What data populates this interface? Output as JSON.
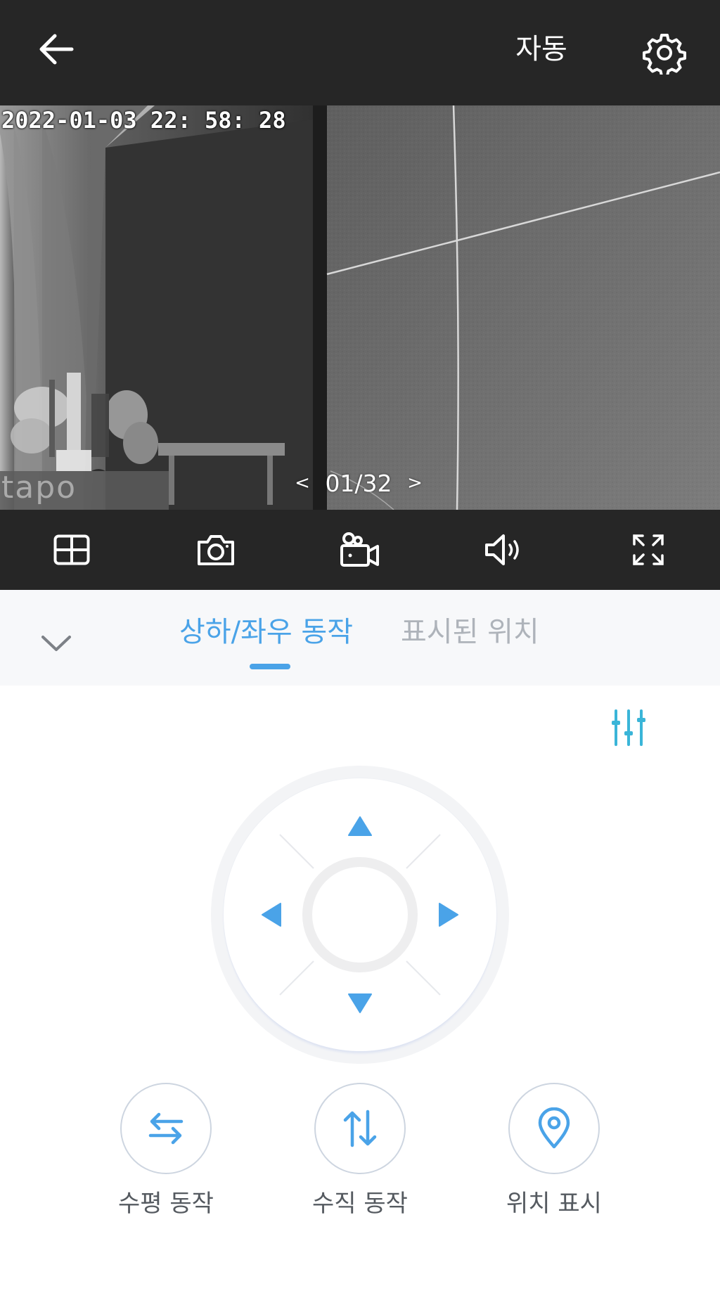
{
  "header": {
    "mode_label": "자동",
    "back_icon": "arrow-left-icon",
    "settings_icon": "gear-icon"
  },
  "video": {
    "timestamp": "2022-01-03  22: 58: 28",
    "watermark": "tapo",
    "pager": {
      "prev": "<",
      "current": "01/32",
      "next": ">"
    }
  },
  "controls": [
    {
      "name": "layout-grid-button",
      "icon": "grid-icon"
    },
    {
      "name": "snapshot-button",
      "icon": "camera-icon"
    },
    {
      "name": "record-button",
      "icon": "video-camera-icon"
    },
    {
      "name": "audio-button",
      "icon": "speaker-icon"
    },
    {
      "name": "fullscreen-button",
      "icon": "expand-icon"
    }
  ],
  "tabs": {
    "active": "상하/좌우 동작",
    "inactive": "표시된 위치"
  },
  "actions": [
    {
      "label": "수평 동작",
      "icon": "horizontal-arrows-icon"
    },
    {
      "label": "수직 동작",
      "icon": "vertical-arrows-icon"
    },
    {
      "label": "위치 표시",
      "icon": "location-pin-icon"
    }
  ],
  "colors": {
    "accent": "#4aa3e8",
    "dark_bar": "#262626",
    "inactive_tab": "#aeb3ba",
    "sliders_icon": "#3ab5d8"
  }
}
